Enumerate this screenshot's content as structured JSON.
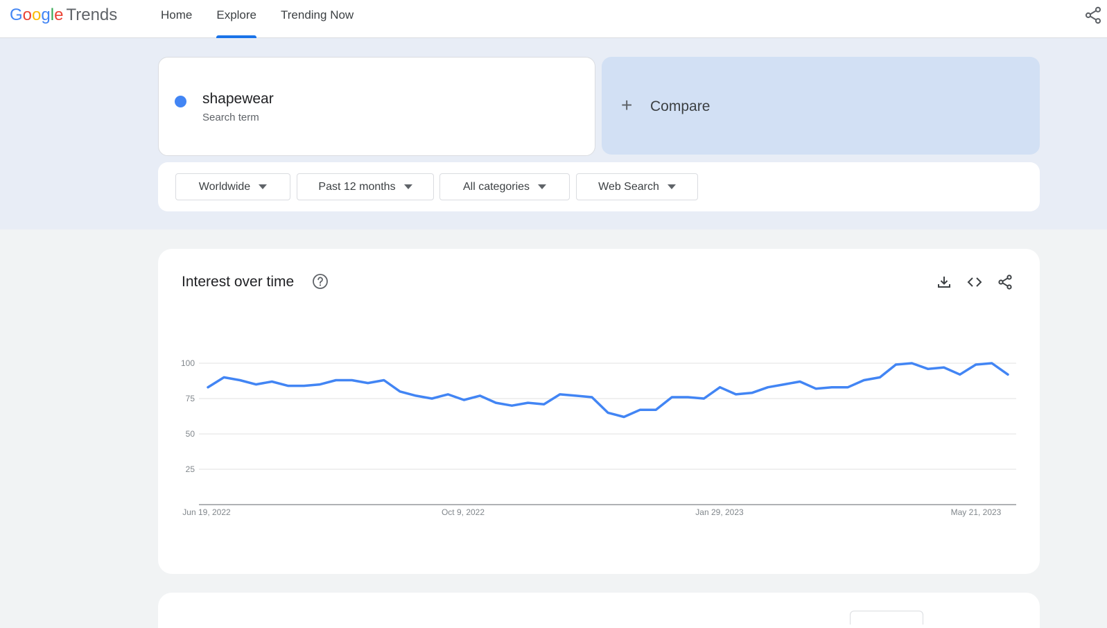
{
  "header": {
    "logo_parts": [
      "G",
      "o",
      "o",
      "g",
      "l",
      "e"
    ],
    "logo_trends": "Trends",
    "tabs": [
      {
        "label": "Home",
        "active": false
      },
      {
        "label": "Explore",
        "active": true
      },
      {
        "label": "Trending Now",
        "active": false
      }
    ]
  },
  "search_term": {
    "name": "shapewear",
    "type": "Search term",
    "color": "#4285f4"
  },
  "compare": {
    "label": "Compare"
  },
  "filters": {
    "region": "Worldwide",
    "time_range": "Past 12 months",
    "category": "All categories",
    "search_type": "Web Search"
  },
  "interest_card": {
    "title": "Interest over time",
    "icons": [
      "help-icon",
      "download-icon",
      "embed-icon",
      "share-icon"
    ]
  },
  "chart_data": {
    "type": "line",
    "x_ticks": [
      "Jun 19, 2022",
      "Oct 9, 2022",
      "Jan 29, 2023",
      "May 21, 2023"
    ],
    "y_ticks": [
      25,
      50,
      75,
      100
    ],
    "ylim": [
      0,
      100
    ],
    "grid": true,
    "series": [
      {
        "color": "#4285f4",
        "values": [
          83,
          90,
          88,
          85,
          87,
          84,
          84,
          85,
          88,
          88,
          86,
          88,
          80,
          77,
          75,
          78,
          74,
          77,
          72,
          70,
          72,
          71,
          78,
          77,
          76,
          65,
          62,
          67,
          67,
          76,
          76,
          75,
          83,
          78,
          79,
          83,
          85,
          87,
          82,
          83,
          83,
          88,
          90,
          99,
          100,
          96,
          97,
          92,
          99,
          100,
          92
        ]
      }
    ]
  }
}
